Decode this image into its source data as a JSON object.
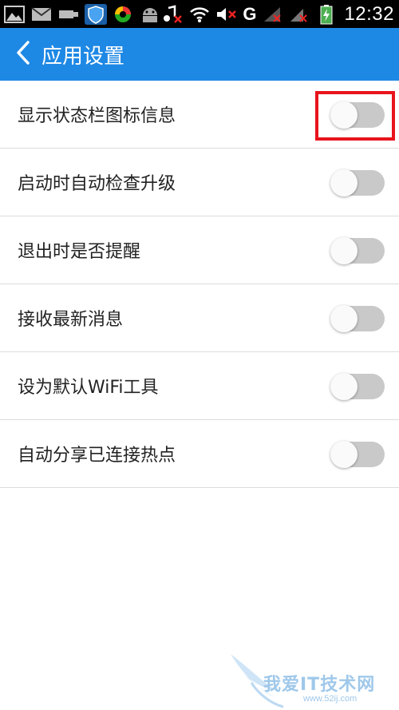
{
  "status_bar": {
    "time": "12:32",
    "network_label": "G",
    "icons": [
      "image-icon",
      "mail-icon",
      "usb-icon",
      "shield-icon",
      "app-icon",
      "android-icon",
      "music-muted-icon",
      "wifi-icon",
      "volume-muted-icon",
      "signal-icon",
      "signal-2-icon",
      "battery-charging-icon"
    ]
  },
  "header": {
    "title": "应用设置",
    "back_icon": "chevron-left-icon",
    "color": "#1e88e5"
  },
  "settings": [
    {
      "label": "显示状态栏图标信息",
      "enabled": false,
      "highlighted": true
    },
    {
      "label": "启动时自动检查升级",
      "enabled": false
    },
    {
      "label": "退出时是否提醒",
      "enabled": false
    },
    {
      "label": "接收最新消息",
      "enabled": false
    },
    {
      "label": "设为默认WiFi工具",
      "enabled": false
    },
    {
      "label": "自动分享已连接热点",
      "enabled": false
    }
  ],
  "watermark": {
    "text": "我爱IT技术网",
    "url": "www.52ij.com"
  }
}
